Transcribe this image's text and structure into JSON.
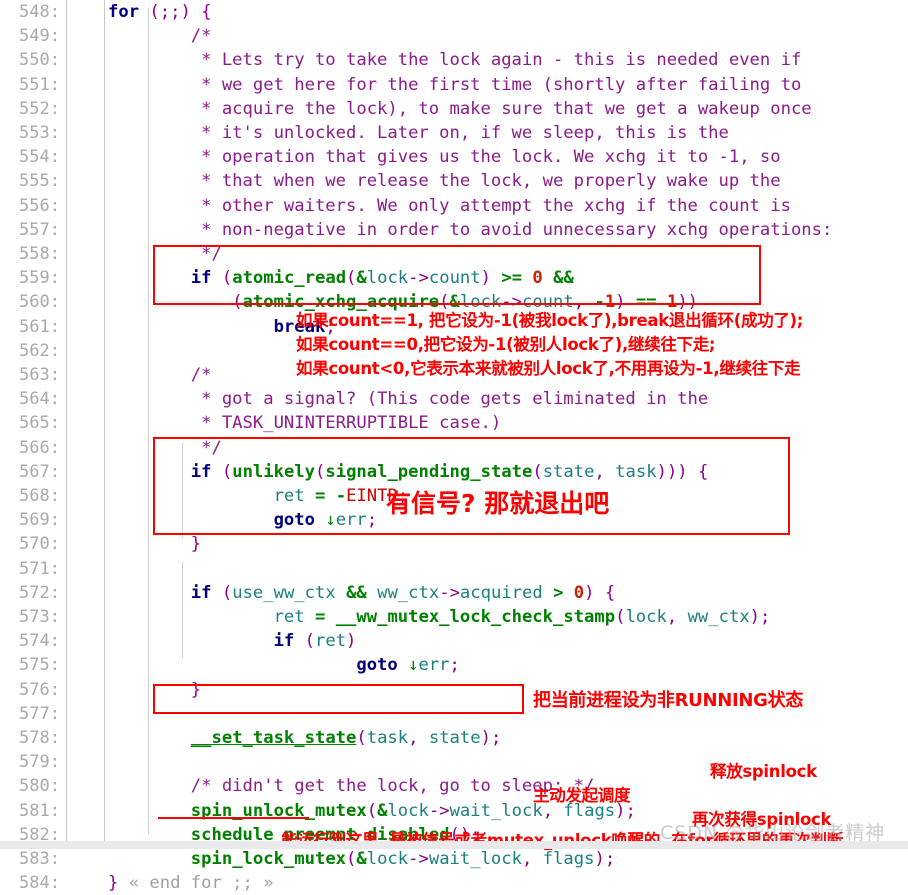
{
  "editor": {
    "language": "C",
    "first_line": 548,
    "last_line": 584,
    "gutter_suffix": ":",
    "colors": {
      "keyword": "#00007f",
      "function": "#008000",
      "punctuation": "#8b008b",
      "variable": "#1a7f7f",
      "number": "#cc2200",
      "comment": "#8b1a8b",
      "macro": "#cc0000",
      "annotation": "#ff0000",
      "highlight_box": "#ff0000",
      "gutter_text": "#a9a9a9",
      "background": "#ffffff"
    }
  },
  "line_numbers": [
    "548:",
    "549:",
    "550:",
    "551:",
    "552:",
    "553:",
    "554:",
    "555:",
    "556:",
    "557:",
    "558:",
    "559:",
    "560:",
    "561:",
    "562:",
    "563:",
    "564:",
    "565:",
    "566:",
    "567:",
    "568:",
    "569:",
    "570:",
    "571:",
    "572:",
    "573:",
    "574:",
    "575:",
    "576:",
    "577:",
    "578:",
    "579:",
    "580:",
    "581:",
    "582:",
    "583:",
    "584:"
  ],
  "code_lines": [
    "for (;;) {",
    "        /*",
    "         * Lets try to take the lock again - this is needed even if",
    "         * we get here for the first time (shortly after failing to",
    "         * acquire the lock), to make sure that we get a wakeup once",
    "         * it's unlocked. Later on, if we sleep, this is the",
    "         * operation that gives us the lock. We xchg it to -1, so",
    "         * that when we release the lock, we properly wake up the",
    "         * other waiters. We only attempt the xchg if the count is",
    "         * non-negative in order to avoid unnecessary xchg operations:",
    "         */",
    "        if (atomic_read(&lock->count) >= 0 &&",
    "            (atomic_xchg_acquire(&lock->count, -1) == 1))",
    "                break;",
    "",
    "        /*",
    "         * got a signal? (This code gets eliminated in the",
    "         * TASK_UNINTERRUPTIBLE case.)",
    "         */",
    "        if (unlikely(signal_pending_state(state, task))) {",
    "                ret = -EINTR;",
    "                goto ↓err;",
    "        }",
    "",
    "        if (use_ww_ctx && ww_ctx->acquired > 0) {",
    "                ret = __ww_mutex_lock_check_stamp(lock, ww_ctx);",
    "                if (ret)",
    "                        goto ↓err;",
    "        }",
    "",
    "        __set_task_state(task, state);",
    "",
    "        /* didn't get the lock, go to sleep: */",
    "        spin_unlock_mutex(&lock->wait_lock, flags);",
    "        schedule_preempt_disabled();",
    "        spin_lock_mutex(&lock->wait_lock, flags);",
    "} « end for ;; »"
  ],
  "annotations": {
    "line561": "如果count==1, 把它设为-1(被我lock了),break退出循环(成功了);",
    "line562": "如果count==0,把它设为-1(被别人lock了),继续往下走;",
    "line563": "如果count<0,它表示本来就被别人lock了,不用再设为-1,继续往下走",
    "signal_note": "有信号? 那就退出吧",
    "line578": "把当前进程设为非RUNNING状态",
    "line581": "释放spinlock",
    "line582": "主动发起调度",
    "line583": "再次获得spinlock",
    "line584": "能运行到这里, 是被信号或者mutex_unlock唤醒的, 在for循环里的再次判断"
  },
  "fold_markers": {
    "end_for": "« end for ;; »"
  },
  "watermark": "CSDN @华山论剑者精神"
}
